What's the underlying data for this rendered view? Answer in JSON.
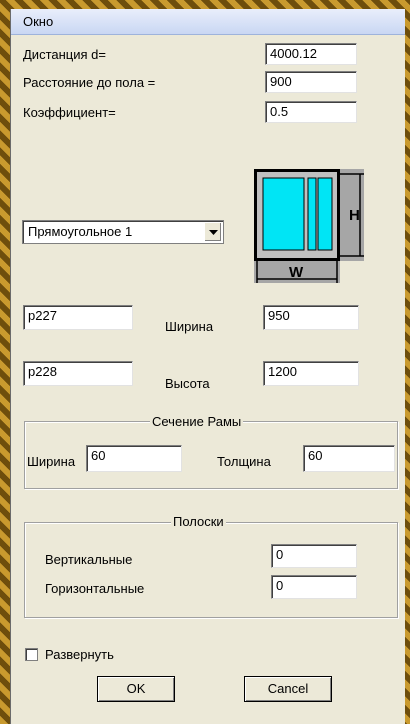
{
  "window": {
    "title": "Окно"
  },
  "params": {
    "distance_label": "Дистанция d=",
    "distance_value": "4000.12",
    "floor_label": "Расстояние до пола =",
    "floor_value": "900",
    "coef_label": "Коэффициент=",
    "coef_value": "0.5"
  },
  "shape_select": {
    "selected": "Прямоугольное 1"
  },
  "preview": {
    "width_label": "W",
    "height_label": "H",
    "glass_color": "#00e5f5",
    "frame_color": "#c0c0c0"
  },
  "size": {
    "code_width": "p227",
    "code_height": "p228",
    "width_label": "Ширина",
    "width_value": "950",
    "height_label": "Высота",
    "height_value": "1200"
  },
  "frame_section": {
    "legend": "Сечение Рамы",
    "width_label": "Ширина",
    "width_value": "60",
    "thickness_label": "Толщина",
    "thickness_value": "60"
  },
  "strips": {
    "legend": "Полоски",
    "vertical_label": "Вертикальные",
    "vertical_value": "0",
    "horizontal_label": "Горизонтальные",
    "horizontal_value": "0"
  },
  "expand": {
    "label": "Развернуть",
    "checked": false
  },
  "buttons": {
    "ok": "OK",
    "cancel": "Cancel"
  }
}
